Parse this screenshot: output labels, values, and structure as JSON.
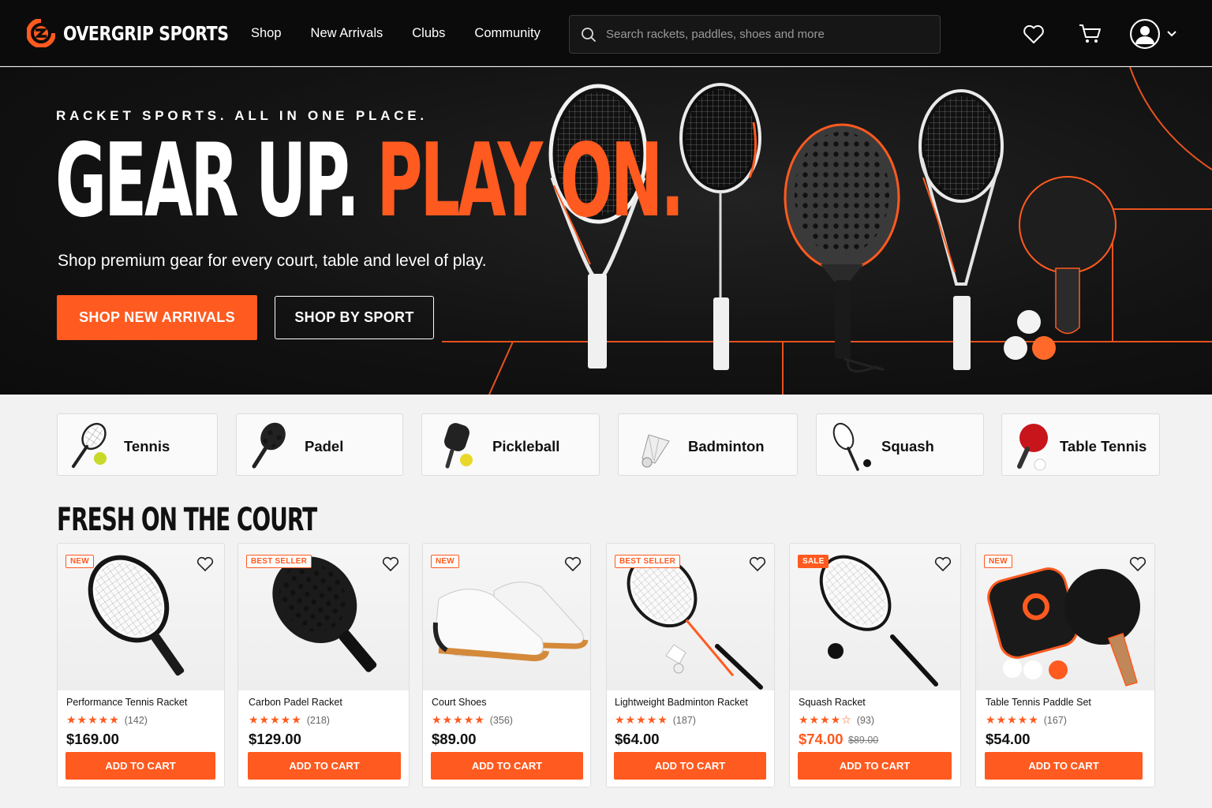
{
  "brand": {
    "name": "OVERGRIP SPORTS",
    "accent": "#ff5a1f"
  },
  "nav": [
    {
      "label": "Shop"
    },
    {
      "label": "New Arrivals"
    },
    {
      "label": "Clubs"
    },
    {
      "label": "Community"
    }
  ],
  "search": {
    "placeholder": "Search rackets, paddles, shoes and more",
    "icon": "search-icon"
  },
  "header_icons": [
    "heart-icon",
    "cart-icon",
    "user-icon",
    "chevron-down-icon"
  ],
  "hero": {
    "eyebrow": "RACKET SPORTS. ALL IN ONE PLACE.",
    "headline_white": "GEAR UP.",
    "headline_orange": "PLAY ON.",
    "subhead": "Shop premium gear for every court, table and level of play.",
    "primary_cta": "SHOP NEW ARRIVALS",
    "secondary_cta": "SHOP BY SPORT"
  },
  "sports": [
    {
      "label": "Tennis",
      "icon": "tennis-racket-icon"
    },
    {
      "label": "Padel",
      "icon": "padel-racket-icon"
    },
    {
      "label": "Pickleball",
      "icon": "pickleball-paddle-icon"
    },
    {
      "label": "Badminton",
      "icon": "shuttlecock-icon"
    },
    {
      "label": "Squash",
      "icon": "squash-racket-icon"
    },
    {
      "label": "Table Tennis",
      "icon": "table-tennis-paddle-icon"
    }
  ],
  "section_title": "FRESH ON THE COURT",
  "products": [
    {
      "badge": "NEW",
      "name": "Performance Tennis Racket",
      "stars": "★★★★★",
      "reviews": "(142)",
      "price": "$169.00",
      "old_price": "",
      "cta": "ADD TO CART"
    },
    {
      "badge": "BEST SELLER",
      "name": "Carbon Padel Racket",
      "stars": "★★★★★",
      "reviews": "(218)",
      "price": "$129.00",
      "old_price": "",
      "cta": "ADD TO CART"
    },
    {
      "badge": "NEW",
      "name": "Court Shoes",
      "stars": "★★★★★",
      "reviews": "(356)",
      "price": "$89.00",
      "old_price": "",
      "cta": "ADD TO CART"
    },
    {
      "badge": "BEST SELLER",
      "name": "Lightweight Badminton Racket",
      "stars": "★★★★★",
      "reviews": "(187)",
      "price": "$64.00",
      "old_price": "",
      "cta": "ADD TO CART"
    },
    {
      "badge": "SALE",
      "name": "Squash Racket",
      "stars": "★★★★☆",
      "reviews": "(93)",
      "price": "$74.00",
      "old_price": "$89.00",
      "cta": "ADD TO CART"
    },
    {
      "badge": "NEW",
      "name": "Table Tennis Paddle Set",
      "stars": "★★★★★",
      "reviews": "(167)",
      "price": "$54.00",
      "old_price": "",
      "cta": "ADD TO CART"
    }
  ]
}
